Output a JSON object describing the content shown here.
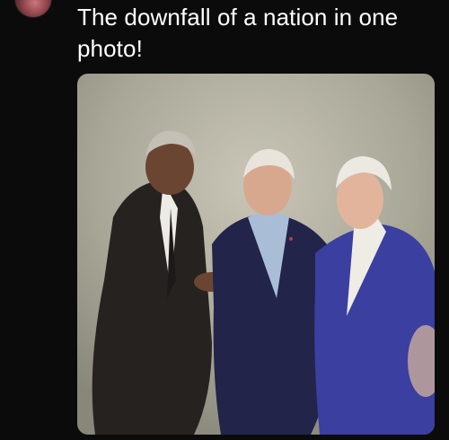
{
  "post": {
    "text": "The downfall of a nation in one photo!",
    "image": {
      "kind": "photo",
      "subject": "three men in suits talking"
    }
  },
  "icons": {
    "follow": "plus-icon",
    "avatar": "profile-photo"
  },
  "colors": {
    "background": "#0b0b0b",
    "text": "#ffffff"
  }
}
